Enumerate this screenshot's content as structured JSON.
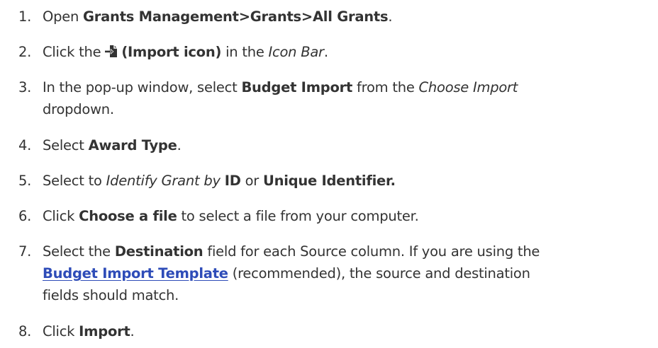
{
  "steps": [
    {
      "number": "1.",
      "text_before": "Open ",
      "path": "Grants Management>Grants>All Grants",
      "text_after": "."
    },
    {
      "number": "2.",
      "text_before": "Click the ",
      "icon": "import-icon",
      "icon_label": "(Import icon)",
      "text_mid": " in the ",
      "icon_bar": "Icon Bar",
      "text_after": "."
    },
    {
      "number": "3.",
      "line1_before": "In the pop-up window, select ",
      "option": "Budget Import",
      "line1_mid": " from the ",
      "dropdown_name": "Choose Import",
      "line2": "dropdown."
    },
    {
      "number": "4.",
      "text_before": "Select ",
      "field": "Award Type",
      "text_after": "."
    },
    {
      "number": "5.",
      "text_before": "Select to ",
      "identify_label": "Identify Grant by",
      "option_id": "ID",
      "text_or": " or ",
      "option_unique": "Unique Identifier."
    },
    {
      "number": "6.",
      "text_before": "Click ",
      "button": "Choose a file",
      "text_after": " to select a file from your computer."
    },
    {
      "number": "7.",
      "line1_before": "Select the ",
      "field": "Destination",
      "line1_after": " field for each Source column. If you are using the",
      "template_link": "Budget Import Template",
      "line2_after": " (recommended), the source and destination",
      "line3": "fields should match."
    },
    {
      "number": "8.",
      "text_before": "Click ",
      "button": "Import",
      "text_after": "."
    }
  ]
}
